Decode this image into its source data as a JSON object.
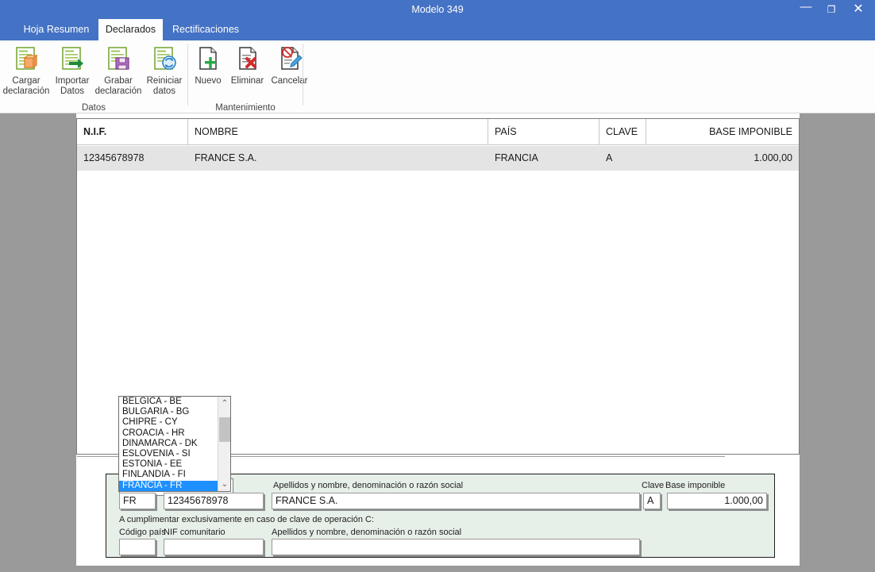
{
  "window": {
    "title": "Modelo 349",
    "minimize_label": "—",
    "maximize_label": "❐",
    "close_label": "✕"
  },
  "tabs": [
    {
      "label": "Hoja Resumen",
      "active": false
    },
    {
      "label": "Declarados",
      "active": true
    },
    {
      "label": "Rectificaciones",
      "active": false
    }
  ],
  "ribbon": {
    "groups": [
      {
        "label": "Datos",
        "buttons": [
          {
            "icon": "load-declaration-icon",
            "line1": "Cargar",
            "line2": "declaración"
          },
          {
            "icon": "import-data-icon",
            "line1": "Importar",
            "line2": "Datos"
          },
          {
            "icon": "save-declaration-icon",
            "line1": "Grabar",
            "line2": "declaración"
          },
          {
            "icon": "reset-data-icon",
            "line1": "Reiniciar",
            "line2": "datos"
          }
        ]
      },
      {
        "label": "Mantenimiento",
        "buttons": [
          {
            "icon": "new-record-icon",
            "line1": "Nuevo",
            "line2": ""
          },
          {
            "icon": "delete-record-icon",
            "line1": "Eliminar",
            "line2": ""
          },
          {
            "icon": "cancel-edit-icon",
            "line1": "Cancelar",
            "line2": ""
          }
        ]
      }
    ]
  },
  "grid": {
    "columns": [
      "N.I.F.",
      "NOMBRE",
      "PAÍS",
      "CLAVE",
      "BASE IMPONIBLE"
    ],
    "rows": [
      {
        "nif": "12345678978",
        "nombre": "FRANCE S.A.",
        "pais": "FRANCIA",
        "clave": "A",
        "base": "1.000,00"
      }
    ]
  },
  "dropdown": {
    "open": true,
    "items": [
      "BÉLGICA - BE",
      "BULGARIA - BG",
      "CHIPRE - CY",
      "CROACIA - HR",
      "DINAMARCA - DK",
      "ESLOVENIA - SI",
      "ESTONIA - EE",
      "FINLANDIA - FI",
      "FRANCIA - FR"
    ],
    "selected": "FRANCIA - FR",
    "scroll_up_glyph": "⌃",
    "scroll_down_glyph": "⌄"
  },
  "form": {
    "labels": {
      "apellidos_1": "Apellidos y nombre, denominación o razón social",
      "clave": "Clave",
      "base_imponible": "Base imponible",
      "nota_clave_c": "A cumplimentar exclusivamente en caso de clave de operación C:",
      "codigo_pais": "Código país",
      "nif_comunitario": "NIF comunitario",
      "apellidos_2": "Apellidos y nombre, denominación o razón social"
    },
    "values": {
      "codigo_pais_1": "FR",
      "nif_1": "12345678978",
      "apellidos_1": "FRANCE S.A.",
      "clave": "A",
      "base_imponible": "1.000,00",
      "codigo_pais_2": "",
      "nif_comunitario": "",
      "apellidos_2": ""
    }
  },
  "colors": {
    "title_bar": "#4472c4",
    "form_panel": "#e7efe9",
    "selection": "#1e90ff",
    "row_selected": "#e4e4e4",
    "desktop": "#9a9a9a"
  }
}
